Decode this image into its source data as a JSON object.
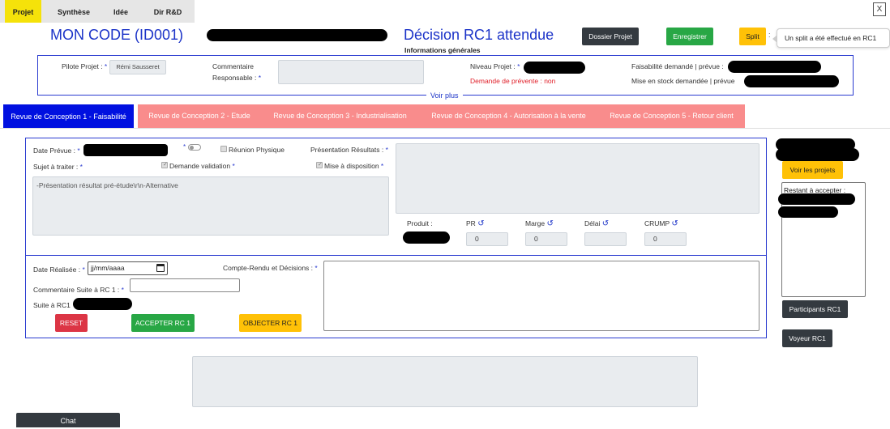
{
  "top_tabs": [
    {
      "label": "Projet",
      "active": true
    },
    {
      "label": "Synthèse",
      "active": false
    },
    {
      "label": "Idée",
      "active": false
    },
    {
      "label": "Dir R&D",
      "active": false
    }
  ],
  "close_label": "X",
  "header": {
    "project_code": "MON CODE (ID001)",
    "status_title": "Décision RC1 attendue",
    "dossier_button": "Dossier Projet",
    "save_button": "Enregistrer",
    "split_button": "Split",
    "split_tooltip": "Un split a été effectué en RC1"
  },
  "info": {
    "legend": "Informations générales",
    "pilote_label": "Pilote Projet :",
    "pilote_value": "Rémi Sausseret",
    "comment_label_1": "Commentaire",
    "comment_label_2": "Responsable :",
    "niveau_label": "Niveau Projet :",
    "prevente": "Demande de prévente : non",
    "faisabilite_label": "Faisabilité demandé | prévue :",
    "stock_label": "Mise en stock demandée | prévue",
    "voir_plus": "Voir plus"
  },
  "rc_tabs": [
    {
      "label": "Revue de Conception 1 - Faisabilité",
      "active": true
    },
    {
      "label": "Revue de Conception 2 - Etude",
      "active": false
    },
    {
      "label": "Revue de Conception 3 - Industrialisation",
      "active": false
    },
    {
      "label": "Revue de Conception 4 - Autorisation à la vente",
      "active": false
    },
    {
      "label": "Revue de Conception 5 - Retour client",
      "active": false
    }
  ],
  "prep": {
    "date_prevue_label": "Date Prévue :",
    "reunion_label": "Réunion Physique",
    "presentation_label": "Présentation Résultats :",
    "sujet_label": "Sujet à traiter :",
    "demande_validation_label": "Demande validation",
    "mise_disposition_label": "Mise à disposition",
    "sujet_text": "-Présentation résultat pré-étude\\r\\n-Alternative",
    "produit_label": "Produit :",
    "metrics": [
      {
        "label": "PR",
        "value": "0"
      },
      {
        "label": "Marge",
        "value": "0"
      },
      {
        "label": "Délai",
        "value": ""
      },
      {
        "label": "CRUMP",
        "value": "0"
      }
    ]
  },
  "result": {
    "date_realisee_label": "Date Réalisée :",
    "date_placeholder": "jj/mm/aaaa",
    "compte_rendu_label": "Compte-Rendu et Décisions :",
    "commentaire_label": "Commentaire Suite à RC 1 :",
    "suite_label": "Suite à RC1",
    "reset_button": "RESET",
    "accept_button": "ACCEPTER RC 1",
    "object_button": "OBJECTER RC 1"
  },
  "side": {
    "voir_projets": "Voir les projets",
    "restant_label": "Restant à accepter :",
    "participants_button": "Participants RC1",
    "voyeur_button": "Voyeur RC1"
  },
  "chat_label": "Chat",
  "colors": {
    "accent_blue": "#1b33c8",
    "active_tab_yellow": "#f5e20a",
    "rc_active": "#0010e0",
    "rc_inactive": "#f98c8c",
    "green": "#28a745",
    "red": "#dc3545",
    "yellow": "#ffc107"
  }
}
